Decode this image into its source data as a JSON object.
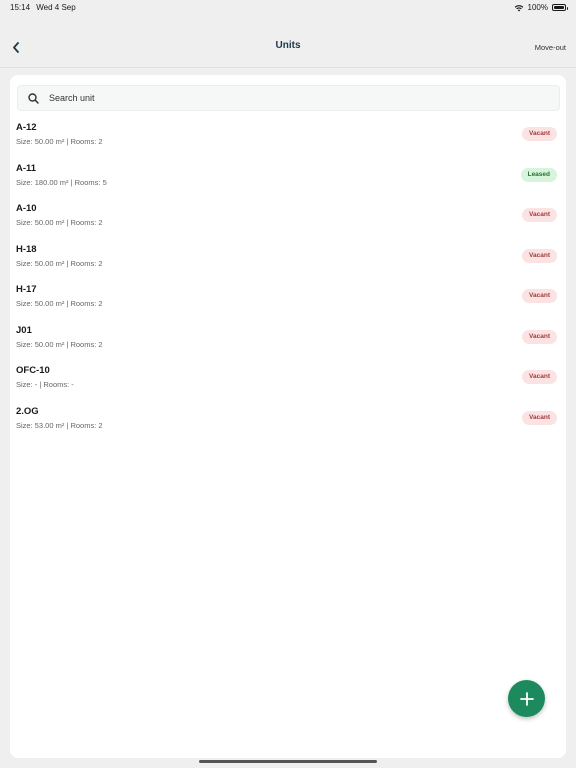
{
  "status_bar": {
    "time": "15:14",
    "date": "Wed 4 Sep",
    "battery": "100%"
  },
  "nav": {
    "title": "Units",
    "right_action": "Move-out"
  },
  "search": {
    "placeholder": "Search unit",
    "value": ""
  },
  "units": [
    {
      "name": "A-12",
      "meta": "Size: 50.00 m²  | Rooms: 2",
      "status": "Vacant",
      "status_type": "vacant"
    },
    {
      "name": "A-11",
      "meta": "Size: 180.00 m²  | Rooms: 5",
      "status": "Leased",
      "status_type": "leased"
    },
    {
      "name": "A-10",
      "meta": "Size: 50.00 m²  | Rooms: 2",
      "status": "Vacant",
      "status_type": "vacant"
    },
    {
      "name": "H-18",
      "meta": "Size: 50.00 m²  | Rooms: 2",
      "status": "Vacant",
      "status_type": "vacant"
    },
    {
      "name": "H-17",
      "meta": "Size: 50.00 m²  | Rooms: 2",
      "status": "Vacant",
      "status_type": "vacant"
    },
    {
      "name": "J01",
      "meta": "Size: 50.00 m²  | Rooms: 2",
      "status": "Vacant",
      "status_type": "vacant"
    },
    {
      "name": "OFC-10",
      "meta": "Size: -  | Rooms: -",
      "status": "Vacant",
      "status_type": "vacant"
    },
    {
      "name": "2.OG",
      "meta": "Size: 53.00 m²  | Rooms: 2",
      "status": "Vacant",
      "status_type": "vacant"
    }
  ],
  "colors": {
    "accent": "#1d8a5e",
    "title": "#1a3a4a",
    "vacant_bg": "#fbe3e3",
    "leased_bg": "#d6f5da"
  },
  "icons": {
    "back": "chevron-left-icon",
    "search": "search-icon",
    "fab": "plus-icon"
  }
}
